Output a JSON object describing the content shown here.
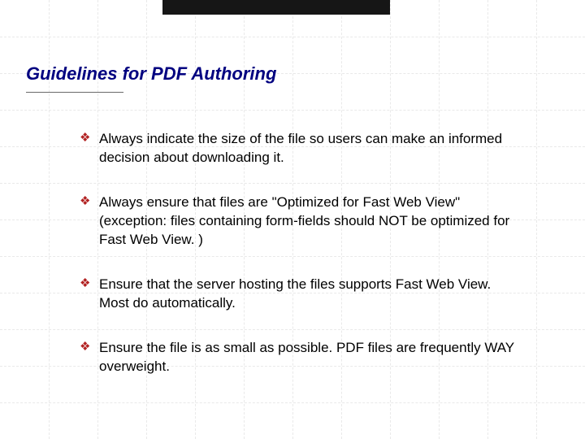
{
  "slide": {
    "title": "Guidelines for PDF Authoring",
    "bullets": [
      "Always indicate the size of the file so users can make an informed decision about downloading it.",
      "Always ensure that files are \"Optimized for Fast Web View\" (exception: files containing form-fields should NOT be optimized for Fast Web View. )",
      "Ensure that the server hosting the files supports Fast Web View. Most do automatically.",
      "Ensure the file is as small as possible. PDF files are frequently WAY overweight."
    ],
    "icon_glyph": "❖"
  },
  "colors": {
    "title": "#000080",
    "bullet_icon": "#b22222"
  }
}
